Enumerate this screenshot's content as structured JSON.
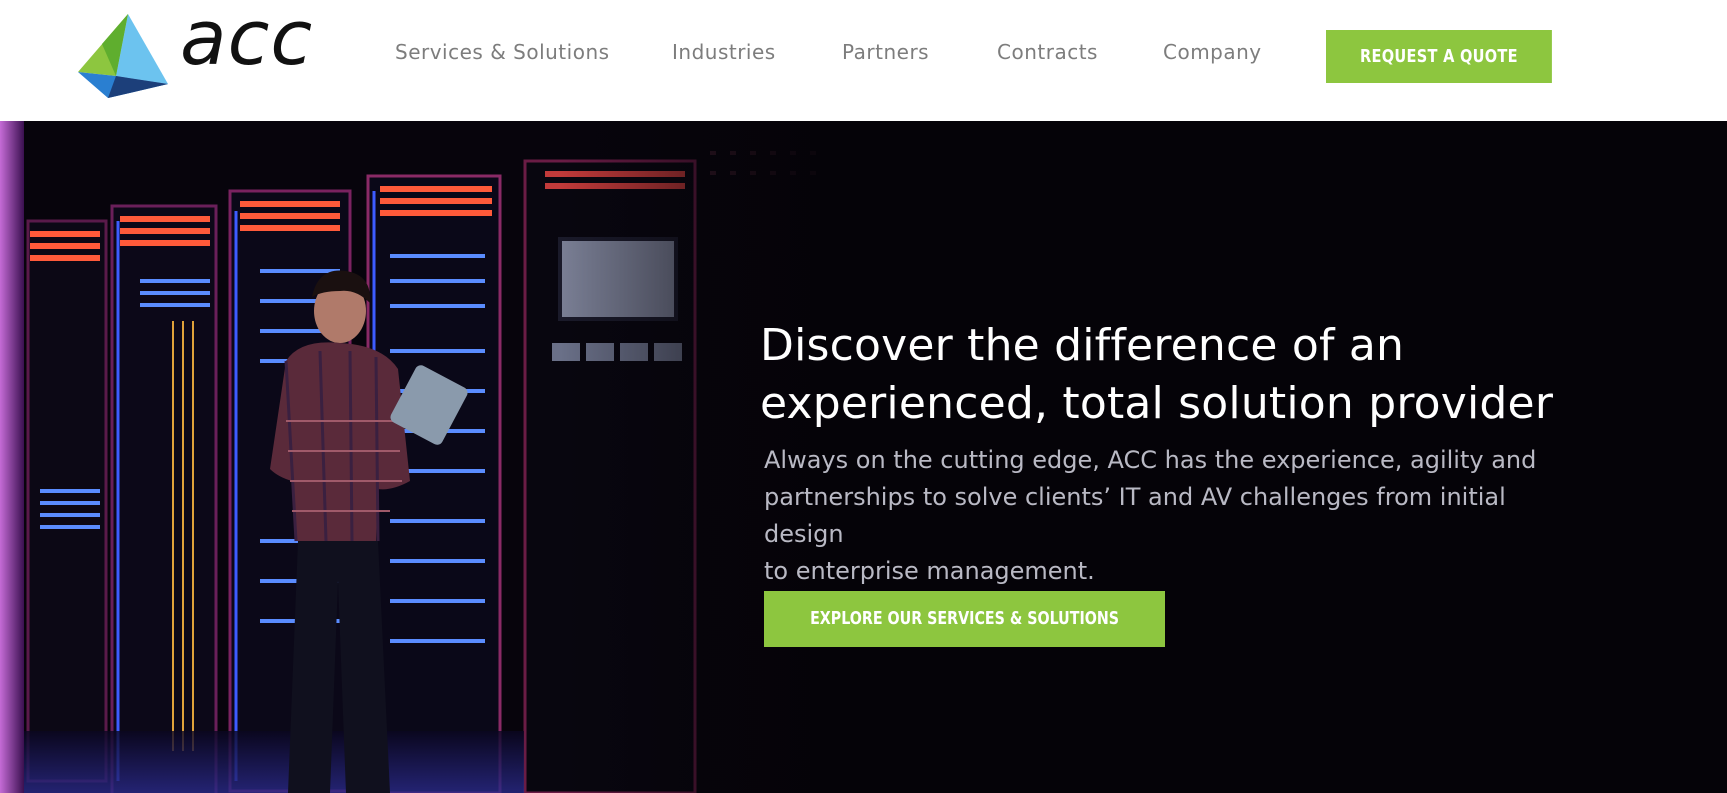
{
  "brand": {
    "name": "acc",
    "colors": {
      "accent_green": "#8dc63f",
      "logo_blue": "#2a7fd1",
      "logo_dark_blue": "#1c3f7a",
      "logo_light_blue": "#6cc3ef",
      "logo_green": "#8dc63f",
      "hero_background": "#050308"
    }
  },
  "nav": {
    "items": [
      {
        "label": "Services & Solutions"
      },
      {
        "label": "Industries"
      },
      {
        "label": "Partners"
      },
      {
        "label": "Contracts"
      },
      {
        "label": "Company"
      }
    ],
    "cta_label": "REQUEST A QUOTE"
  },
  "hero": {
    "image": "data-center-technician-with-tablet",
    "title_line1": "Discover the difference of an",
    "title_line2": "experienced, total solution provider",
    "subtitle_line1": "Always on the cutting edge, ACC has the experience, agility and",
    "subtitle_line2": "partnerships to solve clients’ IT and AV challenges from initial design",
    "subtitle_line3": "to enterprise management.",
    "cta_label": "EXPLORE OUR SERVICES & SOLUTIONS"
  }
}
